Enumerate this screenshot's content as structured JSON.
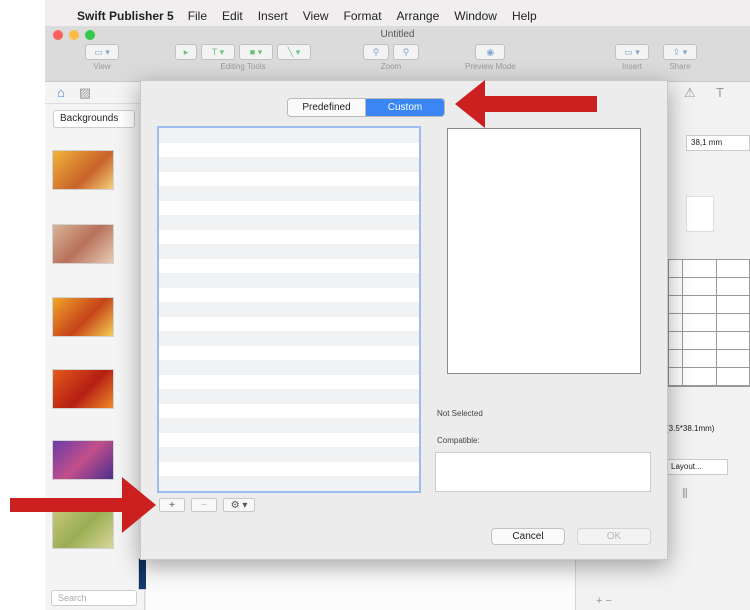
{
  "menubar": {
    "app_name": "Swift Publisher 5",
    "items": [
      "File",
      "Edit",
      "Insert",
      "View",
      "Format",
      "Arrange",
      "Window",
      "Help"
    ]
  },
  "window": {
    "title": "Untitled",
    "toolbar": {
      "view_label": "View",
      "editing_tools_label": "Editing Tools",
      "zoom_label": "Zoom",
      "preview_mode_label": "Preview Mode",
      "insert_label": "Insert",
      "share_label": "Share"
    }
  },
  "left_panel": {
    "category": "Backgrounds",
    "search_placeholder": "Search"
  },
  "right_panel": {
    "dimension_value": "38,1 mm",
    "label_size": "(3.5*38.1mm)",
    "layout_button": "Layout..."
  },
  "dialog": {
    "tabs": [
      {
        "label": "Predefined",
        "selected": false
      },
      {
        "label": "Custom",
        "selected": true
      }
    ],
    "status": "Not Selected",
    "compatible_label": "Compatible:",
    "cancel_label": "Cancel",
    "ok_label": "OK",
    "add_symbol": "+",
    "remove_symbol": "−",
    "gear_symbol": "⚙ ▾"
  },
  "colors": {
    "accent": "#3a86f4",
    "annotation_arrow": "#cc1f1f"
  }
}
